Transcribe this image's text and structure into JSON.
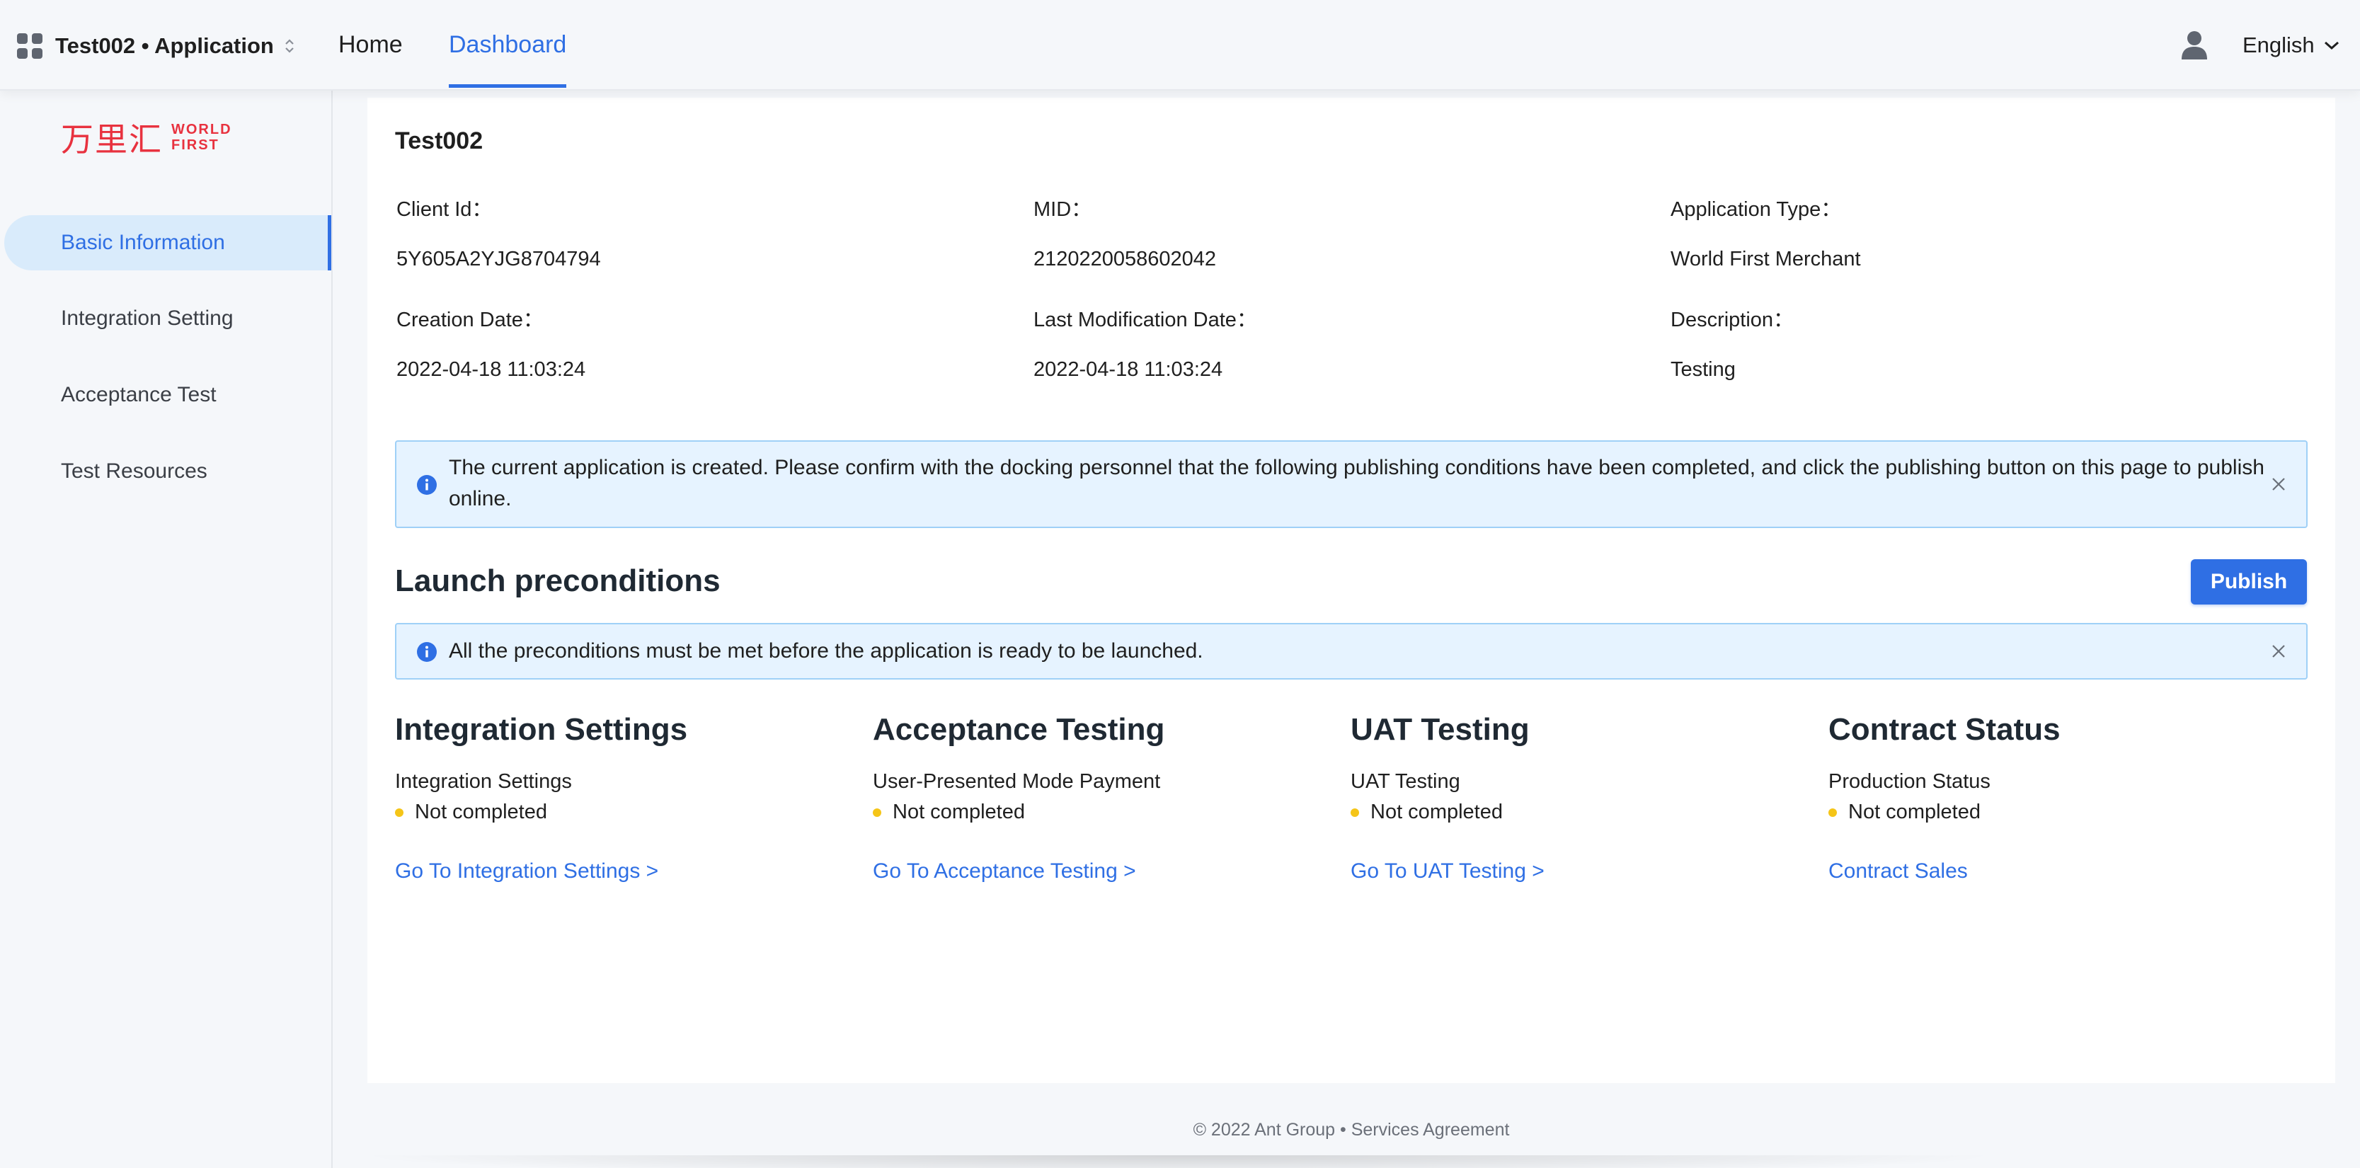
{
  "header": {
    "app_switcher_label": "Test002 • Application",
    "nav": {
      "home": "Home",
      "dashboard": "Dashboard"
    },
    "language": "English"
  },
  "sidebar": {
    "logo": {
      "cn": "万里汇",
      "en_line1": "WORLD",
      "en_line2": "FIRST"
    },
    "items": [
      {
        "label": "Basic Information",
        "active": true
      },
      {
        "label": "Integration Setting",
        "active": false
      },
      {
        "label": "Acceptance Test",
        "active": false
      },
      {
        "label": "Test Resources",
        "active": false
      }
    ]
  },
  "app_info": {
    "title": "Test002",
    "fields": [
      {
        "label": "Client Id：",
        "value": "5Y605A2YJG8704794"
      },
      {
        "label": "MID：",
        "value": "2120220058602042"
      },
      {
        "label": "Application Type：",
        "value": "World First Merchant"
      },
      {
        "label": "Creation Date：",
        "value": "2022-04-18 11:03:24"
      },
      {
        "label": "Last Modification Date：",
        "value": "2022-04-18 11:03:24"
      },
      {
        "label": "Description：",
        "value": "Testing"
      }
    ]
  },
  "alerts": {
    "publish_notice_line1": "The current application is created. Please confirm with the docking personnel that the following publishing conditions have been completed, and click the publishing button on this page to publish",
    "publish_notice_line2": "online.",
    "preconditions_notice": "All the preconditions must be met before the application is ready to be launched."
  },
  "launch": {
    "title": "Launch preconditions",
    "publish_label": "Publish",
    "columns": [
      {
        "title": "Integration Settings",
        "sub": "Integration Settings",
        "status": "Not completed",
        "link": "Go To Integration Settings >"
      },
      {
        "title": "Acceptance Testing",
        "sub": "User-Presented Mode Payment",
        "status": "Not completed",
        "link": "Go To Acceptance Testing >"
      },
      {
        "title": "UAT Testing",
        "sub": "UAT Testing",
        "status": "Not completed",
        "link": "Go To UAT Testing >"
      },
      {
        "title": "Contract Status",
        "sub": "Production Status",
        "status": "Not completed",
        "link": "Contract Sales"
      }
    ],
    "status_color": "#f5c518"
  },
  "footer": {
    "text": "© 2022 Ant Group • Services Agreement"
  },
  "theme": {
    "accent": "#2f6fe4",
    "alert_bg": "#e6f3ff",
    "brand_red": "#e8323f"
  }
}
